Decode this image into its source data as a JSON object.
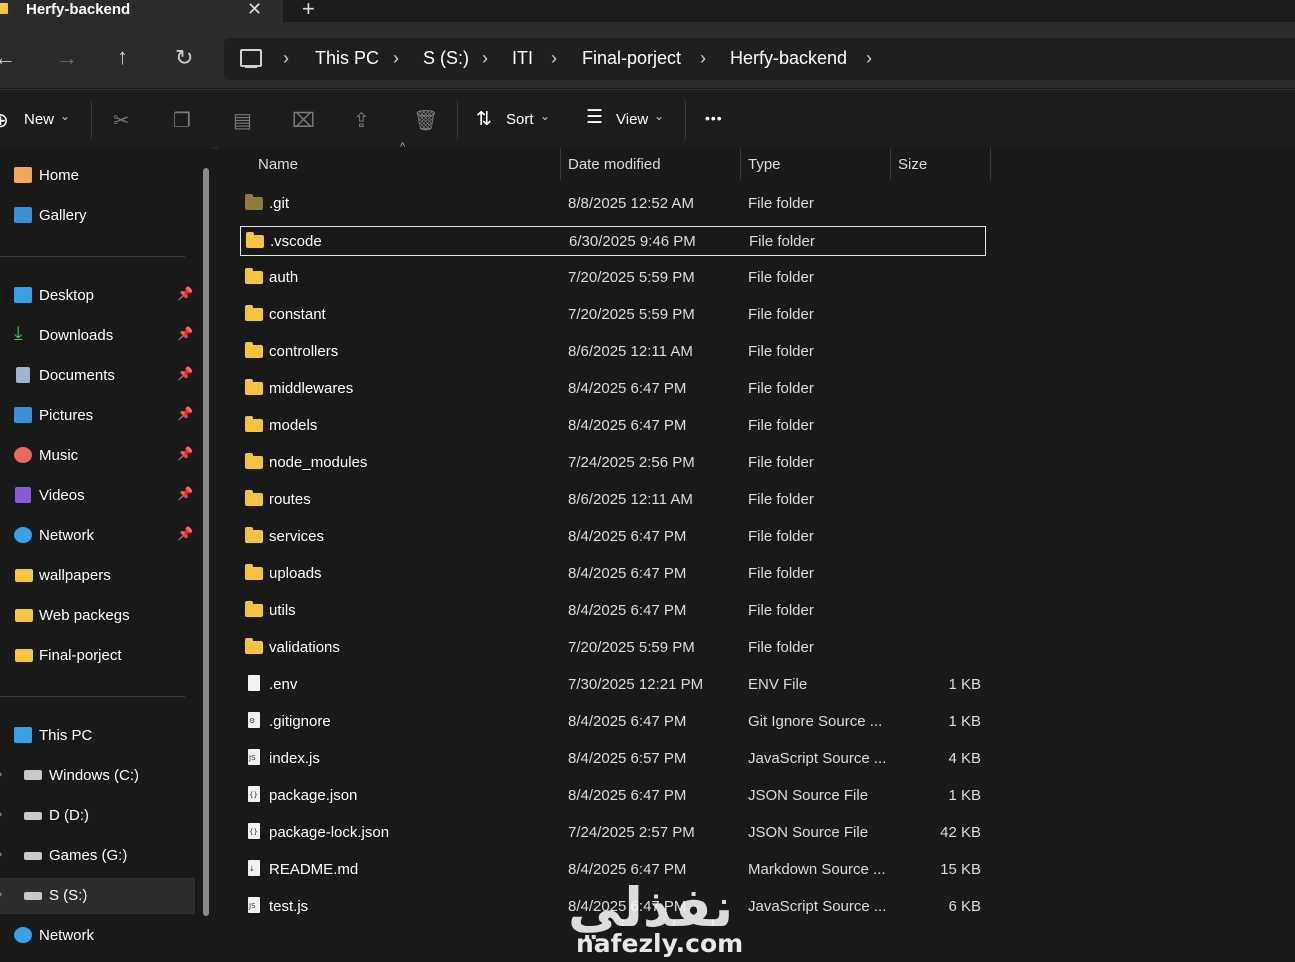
{
  "window": {
    "tab_title": "Herfy-backend",
    "close_glyph": "✕",
    "new_tab_glyph": "+"
  },
  "nav": {
    "back": "←",
    "forward": "→",
    "up": "↑",
    "refresh": "↻",
    "breadcrumbs": [
      "This PC",
      "S (S:)",
      "ITI",
      "Final-porject",
      "Herfy-backend"
    ],
    "chevron": "›"
  },
  "commands": {
    "new_label": "New",
    "sort_label": "Sort",
    "view_label": "View",
    "more_glyph": "•••",
    "dropdown_glyph": "⌄",
    "icons": [
      "cut-icon",
      "copy-icon",
      "paste-icon",
      "rename-icon",
      "share-icon",
      "delete-icon"
    ]
  },
  "sidebar": {
    "top": [
      {
        "label": "Home",
        "icon": "home-icon",
        "color": "#f0a85a"
      },
      {
        "label": "Gallery",
        "icon": "gallery-icon",
        "color": "#3b8fd8"
      }
    ],
    "pinned": [
      {
        "label": "Desktop",
        "icon": "desktop-icon",
        "color": "#3aa0e6"
      },
      {
        "label": "Downloads",
        "icon": "downloads-icon",
        "color": "#4fc26b"
      },
      {
        "label": "Documents",
        "icon": "documents-icon",
        "color": "#9fb4cc"
      },
      {
        "label": "Pictures",
        "icon": "pictures-icon",
        "color": "#3b8fd8"
      },
      {
        "label": "Music",
        "icon": "music-icon",
        "color": "#e76a5a"
      },
      {
        "label": "Videos",
        "icon": "videos-icon",
        "color": "#8a5ad8"
      },
      {
        "label": "Network",
        "icon": "network-icon",
        "color": "#3aa0e6"
      }
    ],
    "folders": [
      {
        "label": "wallpapers"
      },
      {
        "label": "Web packegs"
      },
      {
        "label": "Final-porject"
      }
    ],
    "pc": {
      "label": "This PC"
    },
    "drives": [
      {
        "label": "Windows (C:)"
      },
      {
        "label": "D (D:)"
      },
      {
        "label": "Games (G:)"
      },
      {
        "label": "S (S:)"
      }
    ],
    "network": {
      "label": "Network"
    },
    "pin_glyph": "📌",
    "expand_glyph": "›"
  },
  "columns": {
    "name": "Name",
    "date": "Date modified",
    "type": "Type",
    "size": "Size",
    "sort_caret": "^"
  },
  "files": [
    {
      "name": ".git",
      "date": "8/8/2025 12:52 AM",
      "type": "File folder",
      "size": "",
      "kind": "folder-dim"
    },
    {
      "name": ".vscode",
      "date": "6/30/2025 9:46 PM",
      "type": "File folder",
      "size": "",
      "kind": "folder"
    },
    {
      "name": "auth",
      "date": "7/20/2025 5:59 PM",
      "type": "File folder",
      "size": "",
      "kind": "folder"
    },
    {
      "name": "constant",
      "date": "7/20/2025 5:59 PM",
      "type": "File folder",
      "size": "",
      "kind": "folder"
    },
    {
      "name": "controllers",
      "date": "8/6/2025 12:11 AM",
      "type": "File folder",
      "size": "",
      "kind": "folder"
    },
    {
      "name": "middlewares",
      "date": "8/4/2025 6:47 PM",
      "type": "File folder",
      "size": "",
      "kind": "folder"
    },
    {
      "name": "models",
      "date": "8/4/2025 6:47 PM",
      "type": "File folder",
      "size": "",
      "kind": "folder"
    },
    {
      "name": "node_modules",
      "date": "7/24/2025 2:56 PM",
      "type": "File folder",
      "size": "",
      "kind": "folder"
    },
    {
      "name": "routes",
      "date": "8/6/2025 12:11 AM",
      "type": "File folder",
      "size": "",
      "kind": "folder"
    },
    {
      "name": "services",
      "date": "8/4/2025 6:47 PM",
      "type": "File folder",
      "size": "",
      "kind": "folder"
    },
    {
      "name": "uploads",
      "date": "8/4/2025 6:47 PM",
      "type": "File folder",
      "size": "",
      "kind": "folder"
    },
    {
      "name": "utils",
      "date": "8/4/2025 6:47 PM",
      "type": "File folder",
      "size": "",
      "kind": "folder"
    },
    {
      "name": "validations",
      "date": "7/20/2025 5:59 PM",
      "type": "File folder",
      "size": "",
      "kind": "folder"
    },
    {
      "name": ".env",
      "date": "7/30/2025 12:21 PM",
      "type": "ENV File",
      "size": "1 KB",
      "kind": "file",
      "badge": ""
    },
    {
      "name": ".gitignore",
      "date": "8/4/2025 6:47 PM",
      "type": "Git Ignore Source ...",
      "size": "1 KB",
      "kind": "file",
      "badge": "⚙"
    },
    {
      "name": "index.js",
      "date": "8/4/2025 6:57 PM",
      "type": "JavaScript Source ...",
      "size": "4 KB",
      "kind": "file",
      "badge": "JS"
    },
    {
      "name": "package.json",
      "date": "8/4/2025 6:47 PM",
      "type": "JSON Source File",
      "size": "1 KB",
      "kind": "file",
      "badge": "{}"
    },
    {
      "name": "package-lock.json",
      "date": "7/24/2025 2:57 PM",
      "type": "JSON Source File",
      "size": "42 KB",
      "kind": "file",
      "badge": "{}"
    },
    {
      "name": "README.md",
      "date": "8/4/2025 6:47 PM",
      "type": "Markdown Source ...",
      "size": "15 KB",
      "kind": "file",
      "badge": "↓"
    },
    {
      "name": "test.js",
      "date": "8/4/2025 6:47 PM",
      "type": "JavaScript Source ...",
      "size": "6 KB",
      "kind": "file",
      "badge": "JS"
    }
  ],
  "focused_row": 1,
  "selected_drive": "S (S:)",
  "watermark": {
    "logo": "نفذلي",
    "url": "nafezly.com"
  },
  "colors": {
    "folder": "#f5c342",
    "background": "#191919",
    "bar": "#2b2b2b"
  }
}
